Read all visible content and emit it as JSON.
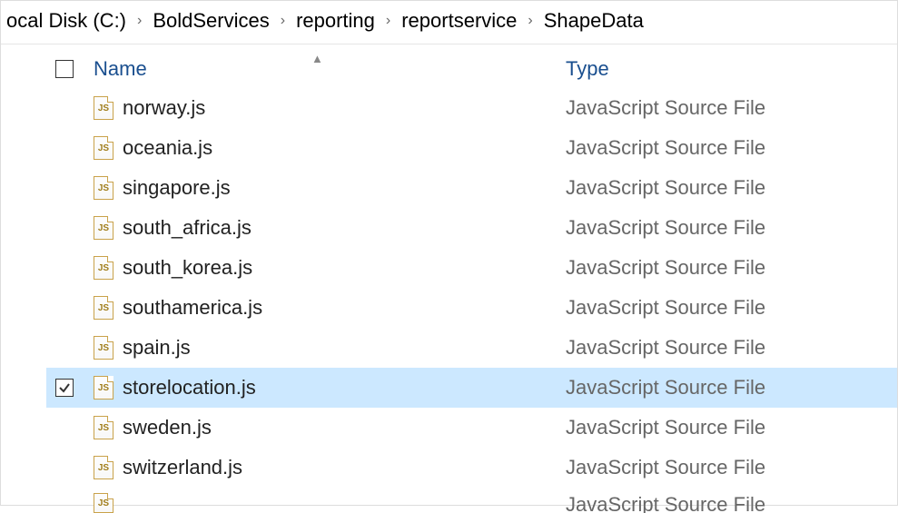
{
  "breadcrumb": {
    "items": [
      {
        "label": "ocal Disk (C:)"
      },
      {
        "label": "BoldServices"
      },
      {
        "label": "reporting"
      },
      {
        "label": "reportservice"
      },
      {
        "label": "ShapeData"
      }
    ],
    "separator": "›"
  },
  "columns": {
    "name": "Name",
    "type": "Type"
  },
  "icon_label": "JS",
  "files": [
    {
      "name": "norway.js",
      "type": "JavaScript Source File",
      "selected": false
    },
    {
      "name": "oceania.js",
      "type": "JavaScript Source File",
      "selected": false
    },
    {
      "name": "singapore.js",
      "type": "JavaScript Source File",
      "selected": false
    },
    {
      "name": "south_africa.js",
      "type": "JavaScript Source File",
      "selected": false
    },
    {
      "name": "south_korea.js",
      "type": "JavaScript Source File",
      "selected": false
    },
    {
      "name": "southamerica.js",
      "type": "JavaScript Source File",
      "selected": false
    },
    {
      "name": "spain.js",
      "type": "JavaScript Source File",
      "selected": false
    },
    {
      "name": "storelocation.js",
      "type": "JavaScript Source File",
      "selected": true
    },
    {
      "name": "sweden.js",
      "type": "JavaScript Source File",
      "selected": false
    },
    {
      "name": "switzerland.js",
      "type": "JavaScript Source File",
      "selected": false
    }
  ],
  "partial_file": {
    "name": "",
    "type": "JavaScript Source File"
  }
}
